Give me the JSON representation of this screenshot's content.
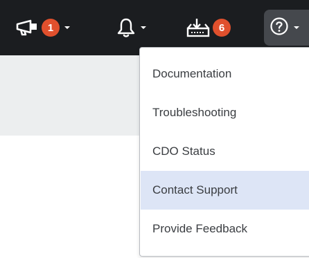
{
  "topbar": {
    "announcements": {
      "icon": "megaphone-icon",
      "badge": "1"
    },
    "notifications": {
      "icon": "bell-icon"
    },
    "downloads": {
      "icon": "download-tray-icon",
      "badge": "6"
    },
    "help": {
      "icon": "question-circle-icon"
    }
  },
  "help_menu": {
    "items": [
      {
        "label": "Documentation"
      },
      {
        "label": "Troubleshooting"
      },
      {
        "label": "CDO Status"
      },
      {
        "label": "Contact Support",
        "highlighted": true
      },
      {
        "label": "Provide Feedback"
      }
    ]
  },
  "colors": {
    "topbar_bg": "#1b1d20",
    "badge_bg": "#e0502d",
    "highlight_bg": "#dde5f6",
    "help_button_bg": "#45484d"
  }
}
